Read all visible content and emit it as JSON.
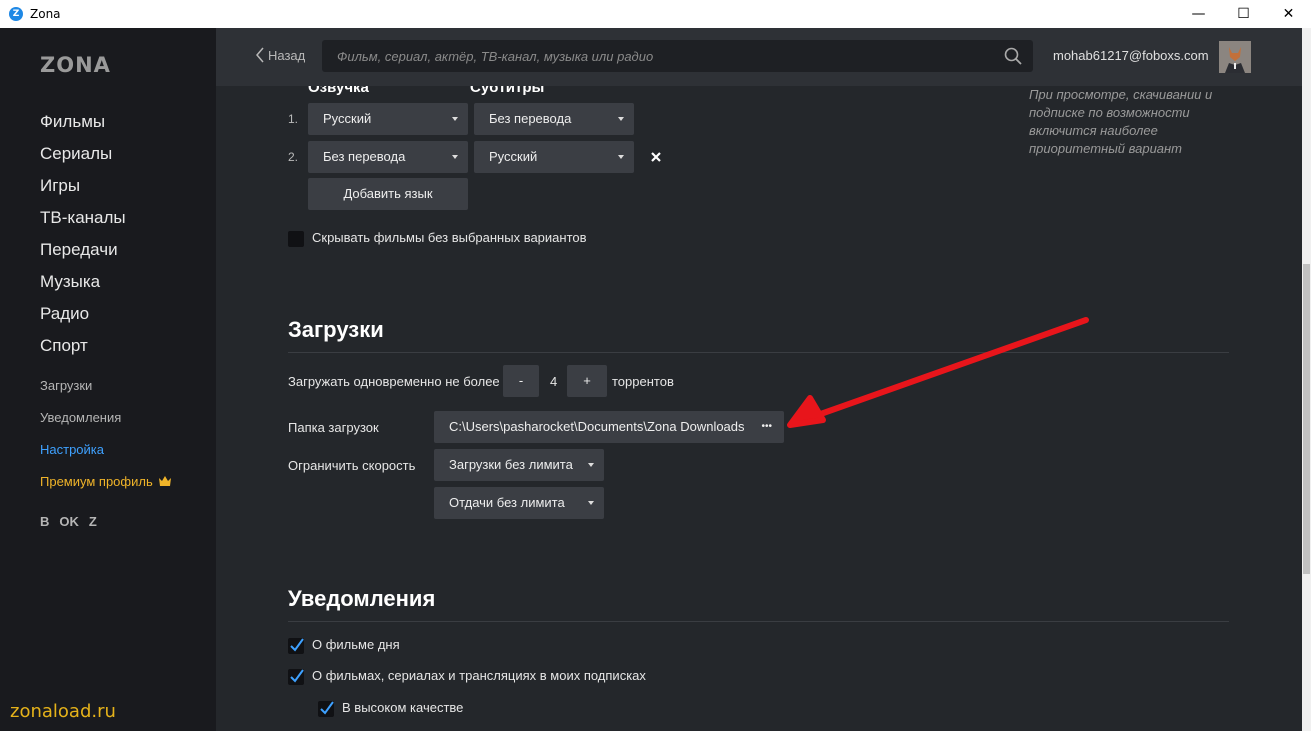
{
  "window": {
    "title": "Zona",
    "logo_letter": "Z",
    "minimize": "—",
    "maximize": "☐",
    "close": "✕"
  },
  "sidebar": {
    "brand": "ZONA",
    "main_items": [
      "Фильмы",
      "Сериалы",
      "Игры",
      "ТВ-каналы",
      "Передачи",
      "Музыка",
      "Радио",
      "Спорт"
    ],
    "sub_items": {
      "downloads": "Загрузки",
      "notifications": "Уведомления",
      "settings": "Настройка",
      "premium": "Премиум профиль"
    },
    "social": [
      "B",
      "OK",
      "Z"
    ],
    "watermark": "zonaload.ru"
  },
  "topbar": {
    "back_label": "Назад",
    "search_placeholder": "Фильм, сериал, актёр, ТВ-канал, музыка или радио",
    "user_email": "mohab61217@foboxs.com"
  },
  "language": {
    "dub_header": "Озвучка",
    "subs_header": "Субтитры",
    "rows": [
      {
        "num": "1.",
        "dub": "Русский",
        "subs": "Без перевода"
      },
      {
        "num": "2.",
        "dub": "Без перевода",
        "subs": "Русский"
      }
    ],
    "add_button": "Добавить язык",
    "hide_label": "Скрывать фильмы без выбранных вариантов",
    "hint": "При просмотре, скачивании и подписке по возможности включится наиболее приоритетный вариант"
  },
  "downloads": {
    "title": "Загрузки",
    "concurrent_label": "Загружать одновременно не более",
    "minus": "-",
    "count": "4",
    "plus": "+",
    "torrents_label": "торрентов",
    "folder_label": "Папка загрузок",
    "folder_path": "C:\\Users\\pasharocket\\Documents\\Zona Downloads",
    "folder_more": "•••",
    "speed_label": "Ограничить скорость",
    "download_limit": "Загрузки без лимита",
    "upload_limit": "Отдачи без лимита"
  },
  "notifications": {
    "title": "Уведомления",
    "items": [
      "О фильме дня",
      "О фильмах, сериалах и трансляциях в моих подписках"
    ],
    "sub_item": "В высоком качестве"
  },
  "colors": {
    "accent": "#3ea1ff",
    "premium": "#f0b429",
    "arrow": "#e8151b",
    "watermark": "#e5b21a"
  }
}
